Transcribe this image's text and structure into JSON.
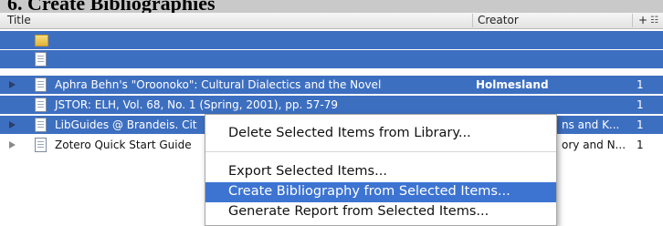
{
  "section_heading": "6. Create Bibliographies",
  "columns": {
    "title": "Title",
    "creator": "Creator",
    "plus": "+"
  },
  "rows": [
    {
      "icon": "folder-icon",
      "title": "",
      "creator": "",
      "num": ""
    },
    {
      "icon": "document-icon",
      "title": "",
      "creator": "",
      "num": ""
    },
    {
      "icon": "document-icon",
      "title": "Aphra Behn's \"Oroonoko\": Cultural Dialectics and the Novel",
      "creator": "Holmesland",
      "num": "1"
    },
    {
      "icon": "document-icon",
      "title": "JSTOR: ELH, Vol. 68, No. 1 (Spring, 2001), pp. 57-79",
      "creator": "",
      "num": "1"
    },
    {
      "icon": "document-icon",
      "title": "LibGuides @ Brandeis. Cit",
      "creator": "ns and K...",
      "num": "1"
    },
    {
      "icon": "document-icon",
      "title": "Zotero Quick Start Guide",
      "creator": "ory and N...",
      "num": "1"
    }
  ],
  "context_menu": {
    "delete": "Delete Selected Items from Library...",
    "export": "Export Selected Items...",
    "create_bibliography": "Create Bibliography from Selected Items...",
    "generate_report": "Generate Report from Selected Items..."
  },
  "colors": {
    "selection": "#3d6fc1",
    "menu_highlight": "#3d74d2"
  }
}
